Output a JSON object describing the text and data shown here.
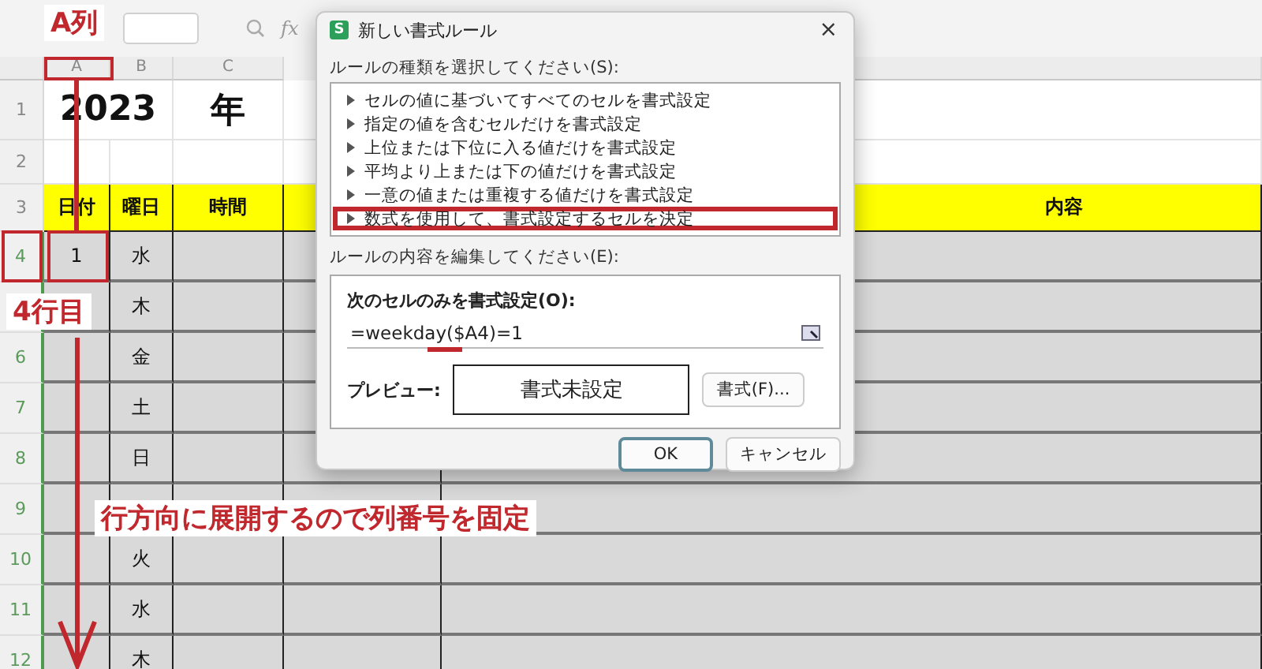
{
  "formula_bar": {
    "fx": "fx"
  },
  "columns": [
    "A",
    "B",
    "C"
  ],
  "rows": [
    {
      "number": "1",
      "kind": "title",
      "a": "2023",
      "c": "年"
    },
    {
      "number": "2",
      "kind": "blank"
    },
    {
      "number": "3",
      "kind": "header",
      "a": "日付",
      "b": "曜日",
      "c": "時間",
      "e": "内容"
    },
    {
      "number": "4",
      "kind": "data",
      "a": "1",
      "b": "水"
    },
    {
      "kind": "data",
      "b": "木"
    },
    {
      "number": "6",
      "kind": "data",
      "b": "金"
    },
    {
      "number": "7",
      "kind": "data",
      "b": "土"
    },
    {
      "number": "8",
      "kind": "data",
      "b": "日"
    },
    {
      "number": "9",
      "kind": "data"
    },
    {
      "number": "10",
      "kind": "data",
      "b": "火"
    },
    {
      "number": "11",
      "kind": "data",
      "b": "水"
    },
    {
      "number": "12",
      "kind": "data",
      "b": "木"
    }
  ],
  "dialog": {
    "app_icon": "S",
    "title": "新しい書式ルール",
    "close": "×",
    "rule_type_label": "ルールの種類を選択してください(S):",
    "rule_types": [
      {
        "label": "セルの値に基づいてすべてのセルを書式設定",
        "selected": false
      },
      {
        "label": "指定の値を含むセルだけを書式設定",
        "selected": false
      },
      {
        "label": "上位または下位に入る値だけを書式設定",
        "selected": false
      },
      {
        "label": "平均より上または下の値だけを書式設定",
        "selected": false
      },
      {
        "label": "一意の値または重複する値だけを書式設定",
        "selected": false
      },
      {
        "label": "数式を使用して、書式設定するセルを決定",
        "selected": true
      }
    ],
    "edit_label": "ルールの内容を編集してください(E):",
    "formula_label": "次のセルのみを書式設定(O):",
    "formula": "=weekday($A4)=1",
    "preview_label": "プレビュー:",
    "preview": "書式未設定",
    "format_button": "書式(F)...",
    "buttons": [
      "OK",
      "キャンセル"
    ]
  },
  "annotations": [
    {
      "kind": "column",
      "text": "A列"
    },
    {
      "kind": "row",
      "text": "4行目"
    },
    {
      "kind": "note",
      "text": "行方向に展開するので列番号を固定"
    }
  ]
}
